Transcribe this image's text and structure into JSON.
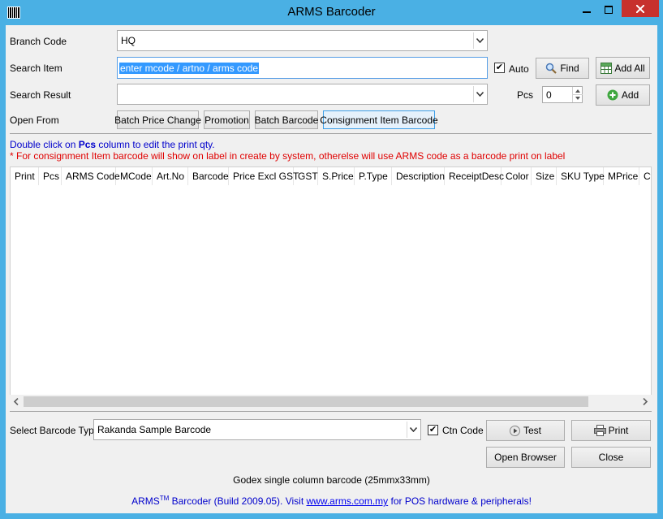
{
  "window": {
    "title": "ARMS Barcoder",
    "minimize_icon": "minimize-icon",
    "maximize_icon": "maximize-icon",
    "close_icon": "close-icon"
  },
  "form": {
    "branch_label": "Branch Code",
    "branch_value": "HQ",
    "search_label": "Search Item",
    "search_value": "enter mcode / artno / arms code",
    "auto_label": "Auto",
    "auto_checked": true,
    "find_label": "Find",
    "add_all_label": "Add All",
    "result_label": "Search Result",
    "result_value": "",
    "pcs_label": "Pcs",
    "pcs_value": "0",
    "add_label": "Add",
    "open_from_label": "Open From",
    "open_from_buttons": [
      "Batch Price Change",
      "Promotion",
      "Batch Barcode",
      "Consignment Item Barcode"
    ]
  },
  "info": {
    "hint_prefix": "Double click on ",
    "hint_bold": "Pcs",
    "hint_suffix": " column to edit the print qty.",
    "note": "* For consignment Item barcode will show on label in create by system, otherelse will use ARMS code as a barcode print on label"
  },
  "grid": {
    "columns": [
      "Print",
      "Pcs",
      "ARMS Code",
      "MCode",
      "Art.No",
      "Barcode",
      "Price Excl GST",
      "GST",
      "S.Price",
      "P.Type",
      "Description",
      "ReceiptDesc",
      "Color",
      "Size",
      "SKU Type",
      "MPrice",
      "Ct"
    ],
    "rows": []
  },
  "bottom": {
    "barcode_type_label": "Select Barcode Type",
    "barcode_type_value": "Rakanda Sample Barcode",
    "ctn_code_label": "Ctn Code",
    "ctn_code_checked": true,
    "test_label": "Test",
    "print_label": "Print",
    "open_browser_label": "Open Browser",
    "close_label": "Close",
    "barcode_desc": "Godex single column barcode (25mmx33mm)",
    "footer_prefix": "ARMS",
    "footer_tm": "TM",
    "footer_mid": " Barcoder (Build 2009.05). Visit ",
    "footer_link": "www.arms.com.my",
    "footer_suffix": " for POS hardware & peripherals!"
  },
  "colors": {
    "titlebar": "#4ab0e4",
    "note_red": "#e00000",
    "hint_blue": "#0000cc",
    "footer_blue": "#0000cc",
    "close_red": "#c7312d"
  }
}
